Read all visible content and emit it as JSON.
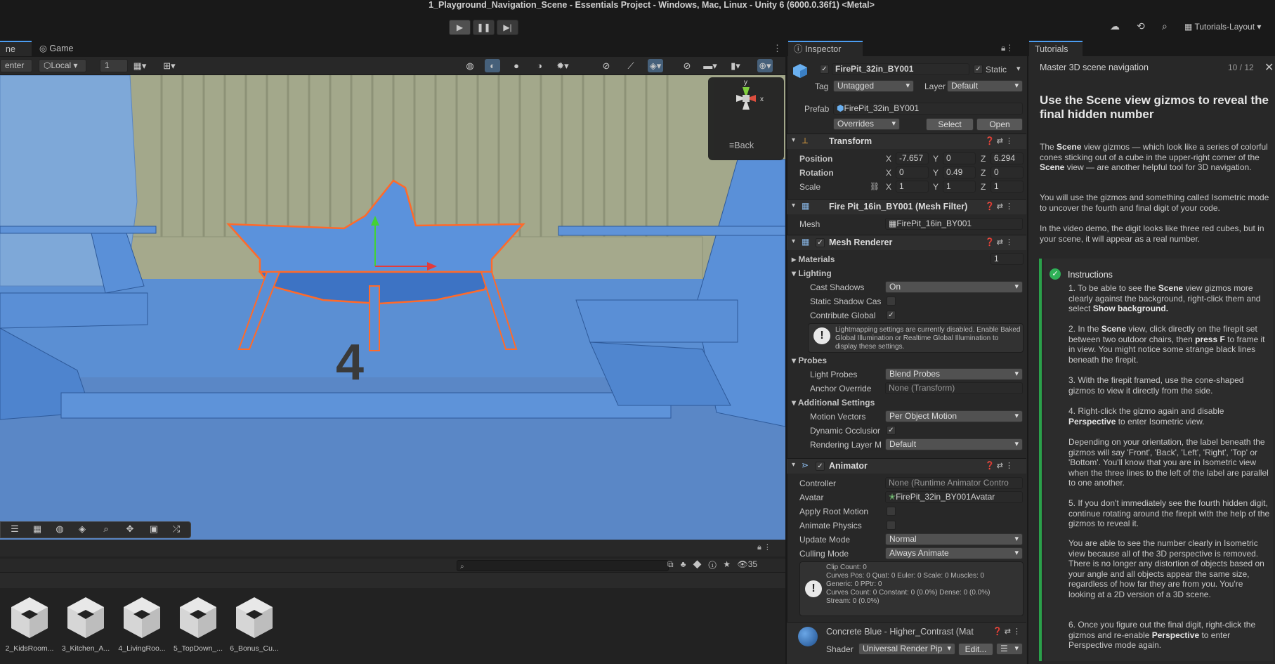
{
  "window": {
    "title": "1_Playground_Navigation_Scene - Essentials Project - Windows, Mac, Linux - Unity 6 (6000.0.36f1) <Metal>",
    "layout_label": "Tutorials-Layout"
  },
  "tabs": {
    "scene": "ne",
    "game": "Game",
    "inspector": "Inspector",
    "tutorials": "Tutorials"
  },
  "scene_toolbar": {
    "pivot": "enter",
    "space": "Local",
    "grid_value": "1"
  },
  "viewport": {
    "gizmo_label": "Back",
    "axis_y": "y",
    "axis_x": "x",
    "hidden_digit": "4"
  },
  "project": {
    "count": "35",
    "assets": [
      "2_KidsRoom...",
      "3_Kitchen_A...",
      "4_LivingRoo...",
      "5_TopDown_...",
      "6_Bonus_Cu..."
    ]
  },
  "inspector": {
    "object_name": "FirePit_32in_BY001",
    "static_label": "Static",
    "tag_label": "Tag",
    "tag_value": "Untagged",
    "layer_label": "Layer",
    "layer_value": "Default",
    "prefab_label": "Prefab",
    "prefab_value": "FirePit_32in_BY001",
    "overrides": "Overrides",
    "select": "Select",
    "open": "Open",
    "transform": {
      "title": "Transform",
      "position_label": "Position",
      "rotation_label": "Rotation",
      "scale_label": "Scale",
      "position": {
        "x": "-7.657",
        "y": "0",
        "z": "6.294"
      },
      "rotation": {
        "x": "0",
        "y": "0.49",
        "z": "0"
      },
      "scale": {
        "x": "1",
        "y": "1",
        "z": "1"
      }
    },
    "mesh_filter": {
      "title": "Fire Pit_16in_BY001 (Mesh Filter)",
      "mesh_label": "Mesh",
      "mesh_value": "FirePit_16in_BY001"
    },
    "mesh_renderer": {
      "title": "Mesh Renderer",
      "materials": "Materials",
      "materials_count": "1",
      "lighting": "Lighting",
      "cast_shadows_label": "Cast Shadows",
      "cast_shadows_value": "On",
      "static_shadow_label": "Static Shadow Cas",
      "contribute_gi_label": "Contribute Global",
      "lightmap_note": "Lightmapping settings are currently disabled. Enable Baked Global Illumination or Realtime Global Illumination to display these settings.",
      "probes": "Probes",
      "light_probes_label": "Light Probes",
      "light_probes_value": "Blend Probes",
      "anchor_label": "Anchor Override",
      "anchor_value": "None (Transform)",
      "additional": "Additional Settings",
      "motion_label": "Motion Vectors",
      "motion_value": "Per Object Motion",
      "dynamic_occlusion_label": "Dynamic Occlusior",
      "rendering_layer_label": "Rendering Layer M",
      "rendering_layer_value": "Default"
    },
    "animator": {
      "title": "Animator",
      "controller_label": "Controller",
      "controller_value": "None (Runtime Animator Contro",
      "avatar_label": "Avatar",
      "avatar_value": "FirePit_32in_BY001Avatar",
      "root_motion_label": "Apply Root Motion",
      "animate_physics_label": "Animate Physics",
      "update_mode_label": "Update Mode",
      "update_mode_value": "Normal",
      "culling_label": "Culling Mode",
      "culling_value": "Always Animate",
      "stats": [
        "Clip Count: 0",
        "Curves Pos: 0 Quat: 0 Euler: 0 Scale: 0 Muscles: 0",
        "Generic: 0 PPtr: 0",
        "Curves Count: 0 Constant: 0 (0.0%) Dense: 0 (0.0%)",
        "Stream: 0 (0.0%)"
      ]
    },
    "material": {
      "name": "Concrete Blue - Higher_Contrast (Mat",
      "shader_label": "Shader",
      "shader_value": "Universal Render Pip",
      "edit": "Edit..."
    }
  },
  "tutorial": {
    "module": "Master 3D scene navigation",
    "progress": "10 / 12",
    "heading": "Use the Scene view gizmos to reveal the final hidden number",
    "intro_1_a": "The ",
    "intro_1_b": "Scene",
    "intro_1_c": " view gizmos — which look like a series of colorful cones sticking out of a cube in the upper-right corner of the ",
    "intro_1_d": "Scene",
    "intro_1_e": " view — are another helpful tool for 3D navigation.",
    "intro_2": "You will use the gizmos and something called Isometric mode to uncover the fourth and final digit of your code.",
    "intro_3": "In the video demo, the digit looks like three red cubes, but in your scene, it will appear as a real number.",
    "instructions_title": "Instructions",
    "step1_a": "1.  To be able to see the ",
    "step1_b": "Scene",
    "step1_c": " view gizmos more clearly against the background, right-click them and select ",
    "step1_d": "Show background.",
    "step2_a": "2.  In the ",
    "step2_b": "Scene",
    "step2_c": " view, click directly on the firepit set between two outdoor chairs, then ",
    "step2_d": "press F",
    "step2_e": " to frame it in view. You might notice some strange black lines beneath the firepit.",
    "step3": "3.  With the firepit framed, use the cone-shaped gizmos to view it directly from the side.",
    "step4_a": "4.  Right-click the gizmo again and disable ",
    "step4_b": "Perspective",
    "step4_c": " to enter Isometric view.",
    "step4_note": "Depending on your orientation, the label beneath the gizmos will say 'Front', 'Back', 'Left', 'Right', 'Top' or 'Bottom'. You'll know that you are in Isometric view when the three lines to the left of the label are parallel to one another.",
    "step5": "5.  If you don't immediately see the fourth hidden digit, continue rotating around the firepit with the help of the gizmos to reveal it.",
    "step5_note": "You are able to see the number clearly in Isometric view because all of the 3D perspective is removed. There is no longer any distortion of objects based on your angle and all objects appear the same size, regardless of how far they are from you. You're looking at a 2D version of a 3D scene.",
    "step6_a": "6.  Once you figure out the final digit, right-click the gizmos and re-enable ",
    "step6_b": "Perspective",
    "step6_c": " to enter Perspective mode again."
  }
}
